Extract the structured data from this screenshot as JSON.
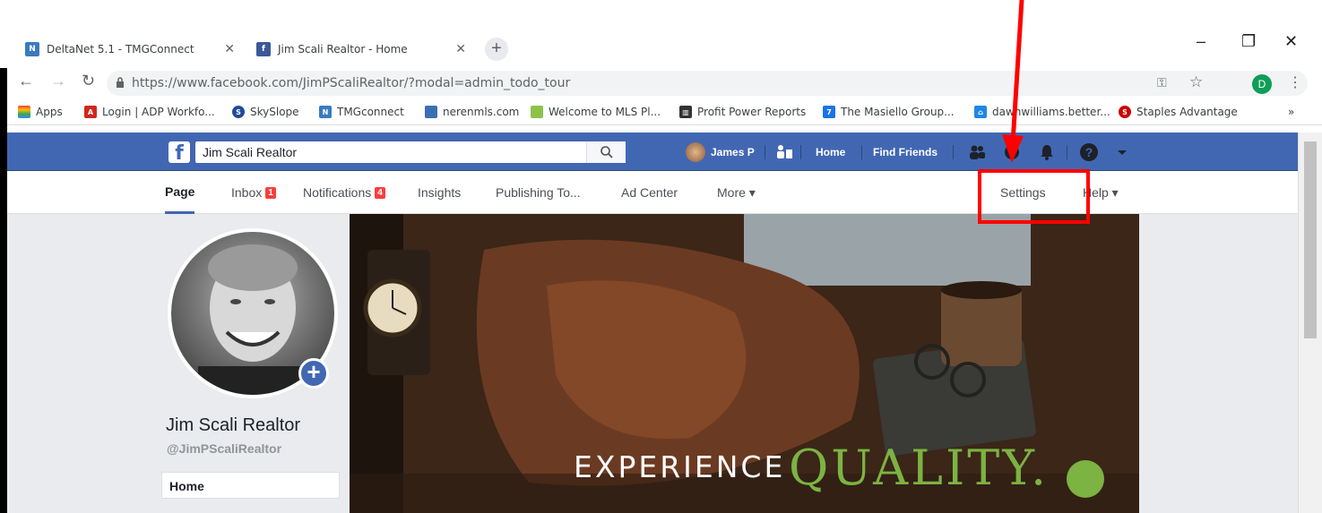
{
  "browser": {
    "tabs": [
      {
        "label": "DeltaNet 5.1 - TMGConnect",
        "favicon": "deltanet-icon"
      },
      {
        "label": "Jim Scali Realtor - Home",
        "favicon": "facebook-icon"
      }
    ],
    "url": "https://www.facebook.com/JimPScaliRealtor/?modal=admin_todo_tour",
    "profile_initial": "D",
    "bookmarks": [
      {
        "label": "Apps"
      },
      {
        "label": "Login | ADP Workfo..."
      },
      {
        "label": "SkySlope"
      },
      {
        "label": "TMGconnect"
      },
      {
        "label": "nerenmls.com"
      },
      {
        "label": "Welcome to MLS Pl..."
      },
      {
        "label": "Profit Power Reports"
      },
      {
        "label": "The Masiello Group..."
      },
      {
        "label": "dawnwilliams.better..."
      },
      {
        "label": "Staples Advantage"
      }
    ],
    "more": "»"
  },
  "facebook": {
    "search_value": "Jim Scali Realtor",
    "user_name": "James P",
    "home": "Home",
    "find_friends": "Find Friends"
  },
  "page_tabs": {
    "page": "Page",
    "inbox": "Inbox",
    "inbox_count": "1",
    "notifications": "Notifications",
    "notifications_count": "4",
    "insights": "Insights",
    "publishing": "Publishing To...",
    "ad_center": "Ad Center",
    "more": "More ▾",
    "settings": "Settings",
    "help": "Help ▾"
  },
  "profile": {
    "name": "Jim Scali Realtor",
    "handle": "@JimPScaliRealtor",
    "nav_home": "Home"
  },
  "cover": {
    "text1": "EXPERIENCE",
    "text2": "QUALITY."
  },
  "colors": {
    "fb_blue": "#4267b2",
    "annotation_red": "#ff0000"
  }
}
